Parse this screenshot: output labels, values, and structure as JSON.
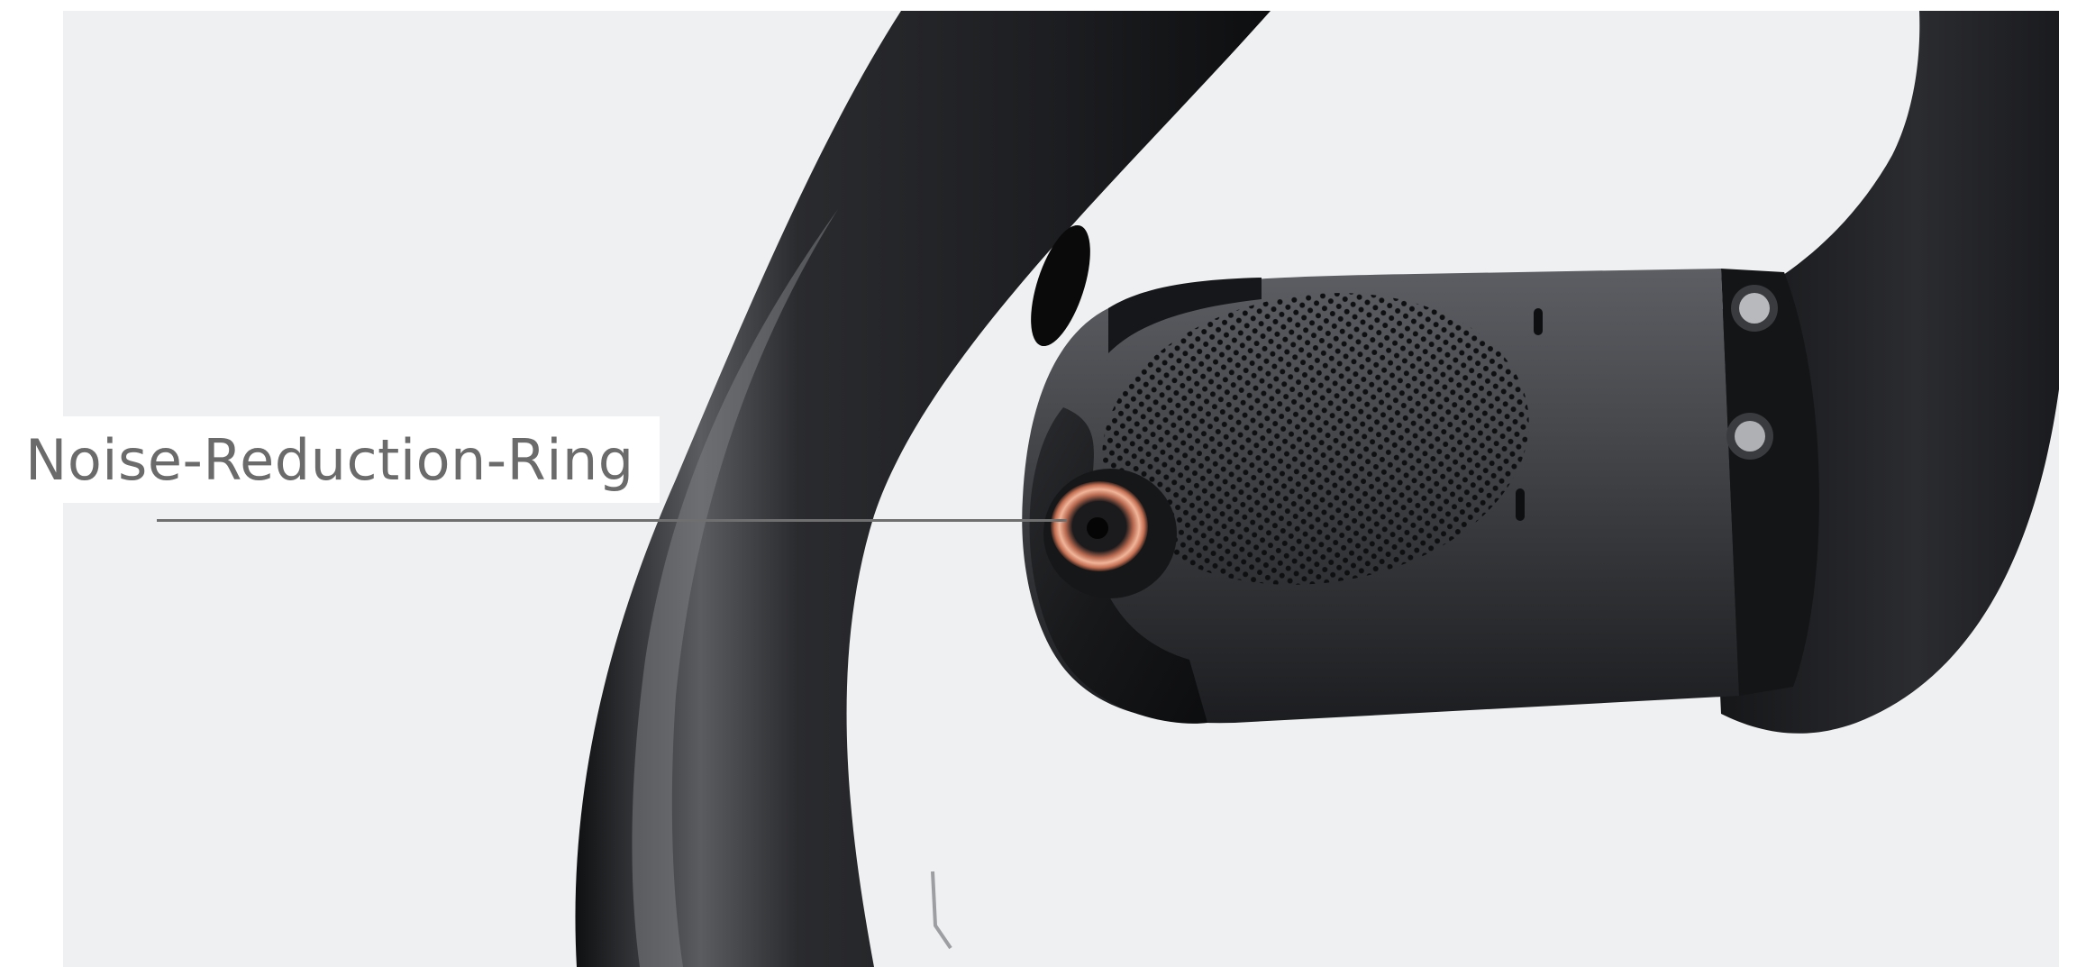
{
  "callout": {
    "label": "Noise-Reduction-Ring"
  },
  "image": {
    "subject": "earbud-product-photo",
    "background_color": "#eff0f1",
    "body_color": "#1e1f22",
    "ring_color": "#d9826a"
  }
}
